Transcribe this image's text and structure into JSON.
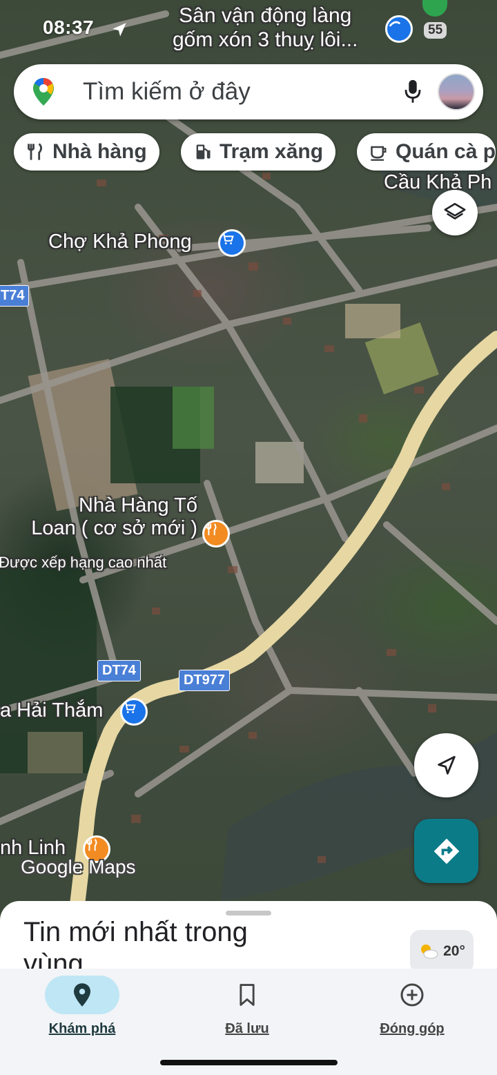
{
  "status_bar": {
    "time": "08:37",
    "signal_badge": "55"
  },
  "search": {
    "placeholder": "Tìm kiếm ở đây"
  },
  "chips": [
    {
      "label": "Nhà hàng",
      "icon": "fork-knife-icon"
    },
    {
      "label": "Trạm xăng",
      "icon": "gas-station-icon"
    },
    {
      "label": "Quán cà p",
      "icon": "coffee-cup-icon"
    }
  ],
  "map": {
    "top_poi": "Sân vận động làng\ngốm xón 3 thuỵ lôi...",
    "pois": {
      "cho_kha_phong": "Chợ Khả Phong",
      "cau_kha_phong": "Cầu Khả Ph",
      "restaurant_name": "Nhà Hàng Tố\nLoan ( cơ sở mới )",
      "restaurant_rating": "Được xếp hạng cao nhất",
      "hai_tham": "a Hải Thắm",
      "linh": "nh Linh"
    },
    "road_shields": {
      "dt74_top": "T74",
      "dt74": "DT74",
      "dt977": "DT977"
    },
    "watermark": "Google Maps"
  },
  "sheet": {
    "title": "Tin mới nhất trong vùng",
    "weather_temp": "20°"
  },
  "nav": [
    {
      "label": "Khám phá",
      "icon": "location-pin-icon",
      "active": true
    },
    {
      "label": "Đã lưu",
      "icon": "bookmark-icon",
      "active": false
    },
    {
      "label": "Đóng góp",
      "icon": "add-circle-icon",
      "active": false
    }
  ],
  "colors": {
    "accent": "#0b7b88",
    "nav_active_pill": "#bfe6f5",
    "road_main": "#e6d7a3",
    "road_minor": "#9a9690"
  }
}
